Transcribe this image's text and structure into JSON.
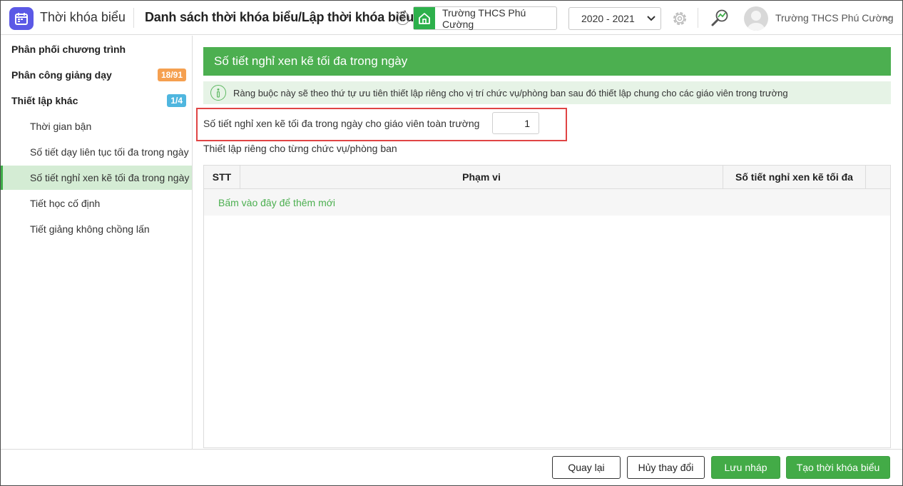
{
  "header": {
    "app_title": "Thời khóa biểu",
    "page_title": "Danh sách thời khóa biểu/Lập thời khóa biểu",
    "help_glyph": "?",
    "school": "Trường THCS Phú Cường",
    "year": "2020 - 2021",
    "user_name": "Trường THCS Phú Cường"
  },
  "sidebar": {
    "items": [
      {
        "label": "Phân phối chương trình"
      },
      {
        "label": "Phân công giảng dạy",
        "badge": "18/91"
      },
      {
        "label": "Thiết lập khác",
        "badge": "1/4"
      },
      {
        "label": "Thời gian bận"
      },
      {
        "label": "Số tiết dạy liên tục tối đa trong ngày"
      },
      {
        "label": "Số tiết nghỉ xen kẽ tối đa trong ngày"
      },
      {
        "label": "Tiết học cố định"
      },
      {
        "label": "Tiết giảng không chồng lấn"
      }
    ]
  },
  "main": {
    "section_title": "Số tiết nghỉ xen kẽ tối đa trong ngày",
    "info_text": "Ràng buộc này sẽ theo thứ tự ưu tiên thiết lập riêng cho vị trí chức vụ/phòng ban sau đó thiết lập chung cho các giáo viên trong trường",
    "setting_label": "Số tiết nghỉ xen kẽ tối đa trong ngày cho giáo viên toàn trường",
    "setting_value": "1",
    "sub_label": "Thiết lập riêng cho từng chức vụ/phòng ban",
    "table": {
      "columns": [
        "STT",
        "Phạm vi",
        "Số tiết nghỉ xen kẽ tối đa"
      ],
      "add_row_text": "Bấm vào đây để thêm mới"
    }
  },
  "footer": {
    "back": "Quay lại",
    "cancel": "Hủy thay đổi",
    "save_draft": "Lưu nháp",
    "create": "Tạo thời khóa biểu"
  },
  "colors": {
    "accent_green": "#4caf50",
    "app_logo": "#5b59e6",
    "badge_orange": "#f5a050",
    "badge_blue": "#4fb6df",
    "highlight_red": "#e04444"
  },
  "icons": {
    "app_logo": "calendar-icon",
    "help": "question-icon",
    "school": "home-icon",
    "year_dropdown": "chevron-down-icon",
    "settings": "gear-icon",
    "tools": "search-chart-icon",
    "user": "avatar-icon",
    "user_menu": "chevron-down-icon",
    "info": "info-icon"
  }
}
